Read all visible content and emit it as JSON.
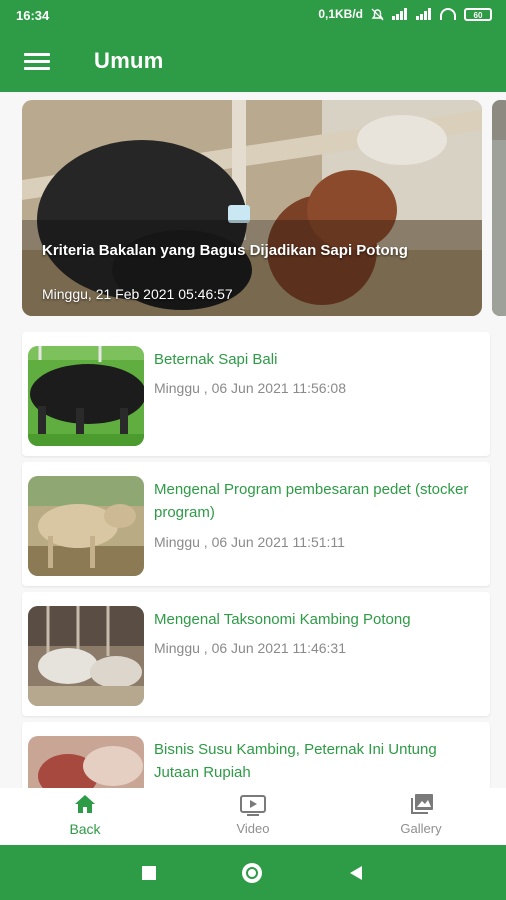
{
  "status_bar": {
    "time": "16:34",
    "speed": "0,1KB/d",
    "battery": "60"
  },
  "app_bar": {
    "title": "Umum",
    "menu_icon": "hamburger-menu-icon"
  },
  "featured": {
    "title": "Kriteria Bakalan yang Bagus Dijadikan Sapi Potong",
    "date": "Minggu, 21 Feb 2021  05:46:57"
  },
  "articles": [
    {
      "title": "Beternak Sapi Bali",
      "date": "Minggu , 06 Jun 2021 11:56:08"
    },
    {
      "title": "Mengenal Program pembesaran pedet (stocker program)",
      "date": "Minggu , 06 Jun 2021 11:51:11"
    },
    {
      "title": "Mengenal Taksonomi Kambing Potong",
      "date": "Minggu , 06 Jun 2021 11:46:31"
    },
    {
      "title": "Bisnis Susu Kambing, Peternak Ini Untung Jutaan Rupiah",
      "date": ""
    }
  ],
  "bottom_nav": {
    "items": [
      {
        "label": "Back",
        "icon": "home-icon",
        "active": true
      },
      {
        "label": "Video",
        "icon": "video-icon",
        "active": false
      },
      {
        "label": "Gallery",
        "icon": "gallery-icon",
        "active": false
      }
    ]
  },
  "colors": {
    "primary": "#2e9b46",
    "title_green": "#2e9b46",
    "date_gray": "#8a8a8a",
    "inactive_nav": "#8f8f8f"
  }
}
